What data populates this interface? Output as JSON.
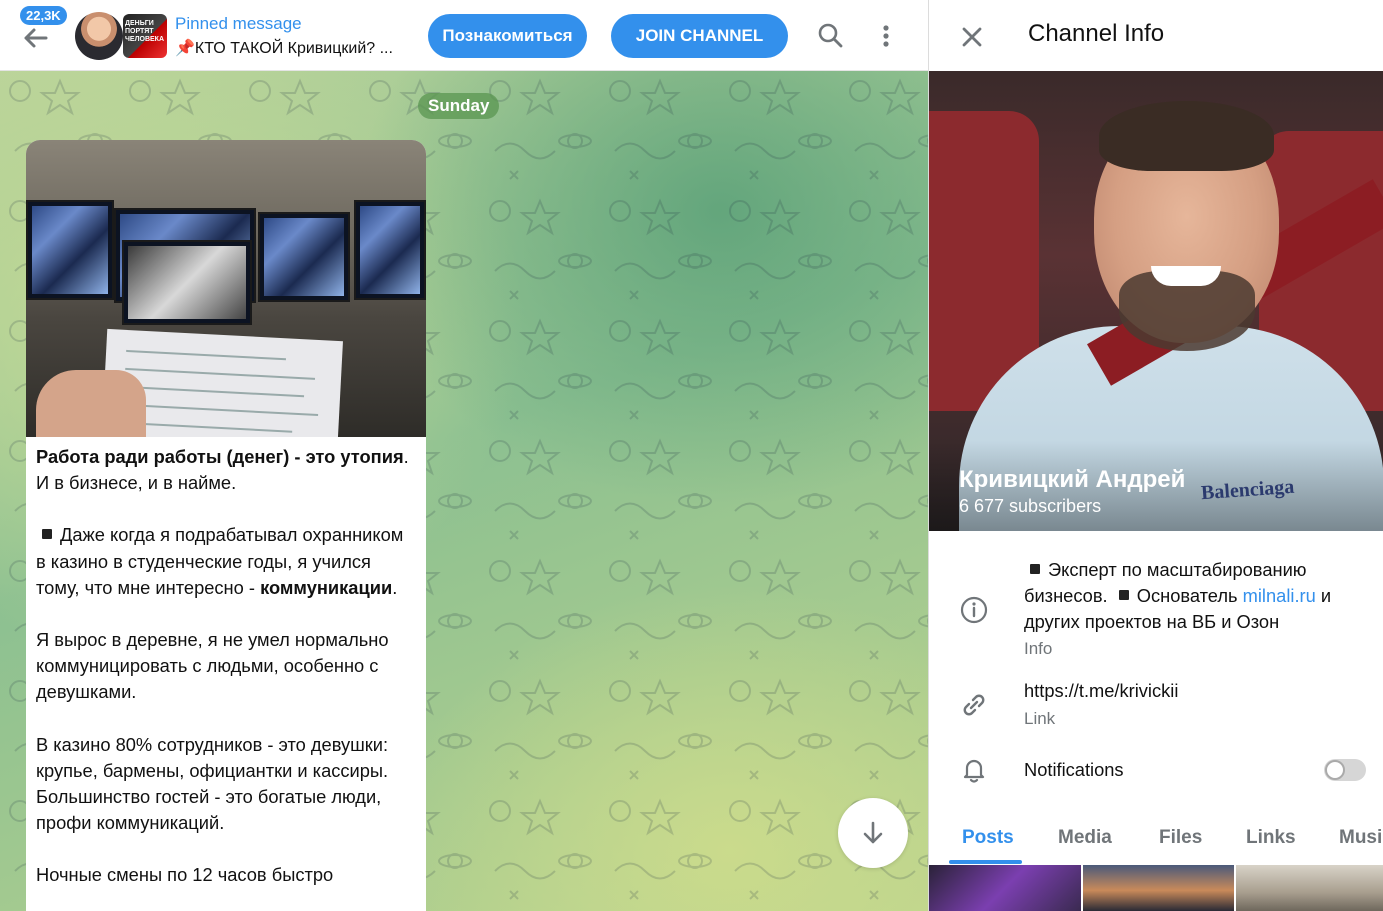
{
  "header": {
    "unread_count": "22,3K",
    "pinned_title": "Pinned message",
    "pinned_text": "📌КТО ТАКОЙ Кривицкий? ...",
    "pinned_thumb_text": "ДЕНЬГИ ПОРТЯТ ЧЕЛОВЕКА",
    "meet_button": "Познакомиться",
    "join_button": "JOIN CHANNEL"
  },
  "chat": {
    "date_label": "Sunday",
    "message": {
      "p1_bold": "Работа ради работы (денег) - это утопия",
      "p1_rest": ". И в бизнесе, и в найме.",
      "p2_text": "Даже когда я подрабатывал охранником в казино в студенческие годы, я учился тому, что мне интересно - ",
      "p2_bold": "коммуникации",
      "p2_end": ".",
      "p3": "Я вырос в деревне, я не умел нормально коммуницировать с людьми, особенно с девушками.",
      "p4": "В казино 80% сотрудников - это девушки: крупье, бармены, официантки и кассиры. Большинство гостей - это богатые люди, профи коммуникаций.",
      "p5": "Ночные смены по 12 часов быстро"
    }
  },
  "panel": {
    "title": "Channel Info",
    "channel_name": "Кривицкий Андрей",
    "subscribers": "6 677 subscribers",
    "cover_brand_text": "Balenciaga",
    "info": {
      "line_a": "Эксперт по масштабированию бизнесов.",
      "line_b": "Основатель ",
      "link_text": "milnali.ru",
      "line_c": " и других проектов на ВБ и Озон",
      "caption": "Info"
    },
    "link": {
      "value": "https://t.me/krivickii",
      "caption": "Link"
    },
    "notifications": {
      "label": "Notifications",
      "enabled": false
    },
    "tabs": [
      "Posts",
      "Media",
      "Files",
      "Links",
      "Music"
    ],
    "active_tab": "Posts"
  },
  "colors": {
    "accent": "#3390ec",
    "text": "#111111",
    "secondary": "#707579"
  },
  "icons": [
    "back-arrow-icon",
    "search-icon",
    "more-vertical-icon",
    "close-icon",
    "info-icon",
    "link-icon",
    "bell-icon",
    "arrow-down-icon"
  ]
}
